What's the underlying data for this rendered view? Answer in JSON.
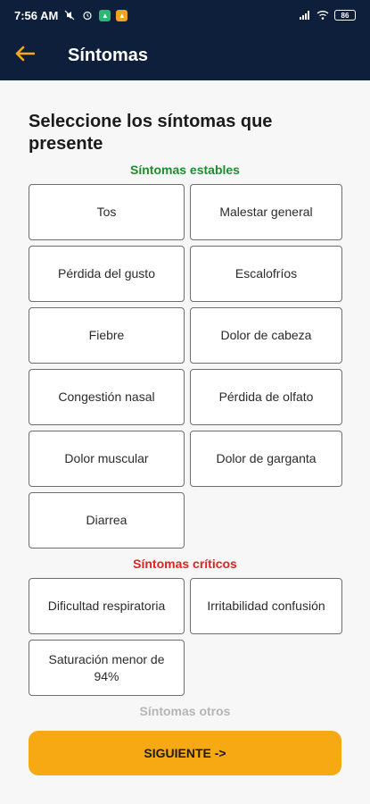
{
  "status_bar": {
    "time": "7:56 AM",
    "battery": "86",
    "icons": [
      "mute-icon",
      "alarm-icon",
      "app-notification-icon",
      "app-notification-icon",
      "signal-icon",
      "wifi-icon",
      "battery-icon"
    ]
  },
  "app_bar": {
    "back_icon": "arrow-left-icon",
    "title": "Síntomas"
  },
  "main": {
    "heading": "Seleccione los síntomas que presente",
    "stable": {
      "title": "Síntomas estables",
      "items": [
        "Tos",
        "Malestar general",
        "Pérdida del gusto",
        "Escalofríos",
        "Fiebre",
        "Dolor de cabeza",
        "Congestión nasal",
        "Pérdida de olfato",
        "Dolor muscular",
        "Dolor de garganta",
        "Diarrea"
      ]
    },
    "critical": {
      "title": "Síntomas críticos",
      "items": [
        "Dificultad respiratoria",
        "Irritabilidad confusión",
        "Saturación menor de 94%"
      ]
    },
    "others": {
      "title": "Síntomas otros"
    },
    "next_button": "SIGUIENTE ->"
  },
  "colors": {
    "app_bar_bg": "#0e1f3b",
    "accent": "#f7a913",
    "stable_title": "#1e8e2b",
    "critical_title": "#e12222",
    "others_title": "#b5b5b5"
  }
}
